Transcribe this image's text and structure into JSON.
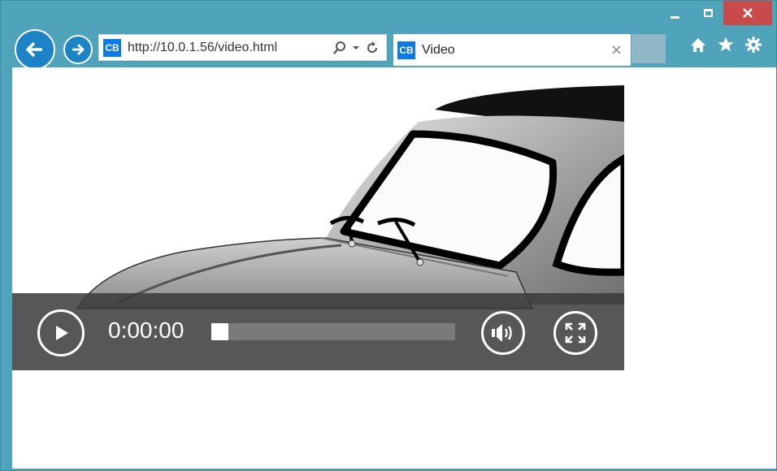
{
  "browser": {
    "address_url": "http://10.0.1.56/video.html",
    "favicon_text": "CB",
    "tab_title": "Video",
    "tab_close": "×"
  },
  "player": {
    "time": "0:00:00",
    "progress": 0.07
  },
  "icons": [
    "minimize-icon",
    "maximize-icon",
    "close-icon",
    "back-arrow-icon",
    "forward-arrow-icon",
    "search-icon",
    "dropdown-icon",
    "refresh-icon",
    "home-icon",
    "star-icon",
    "gear-icon",
    "play-icon",
    "volume-icon",
    "fullscreen-icon"
  ]
}
